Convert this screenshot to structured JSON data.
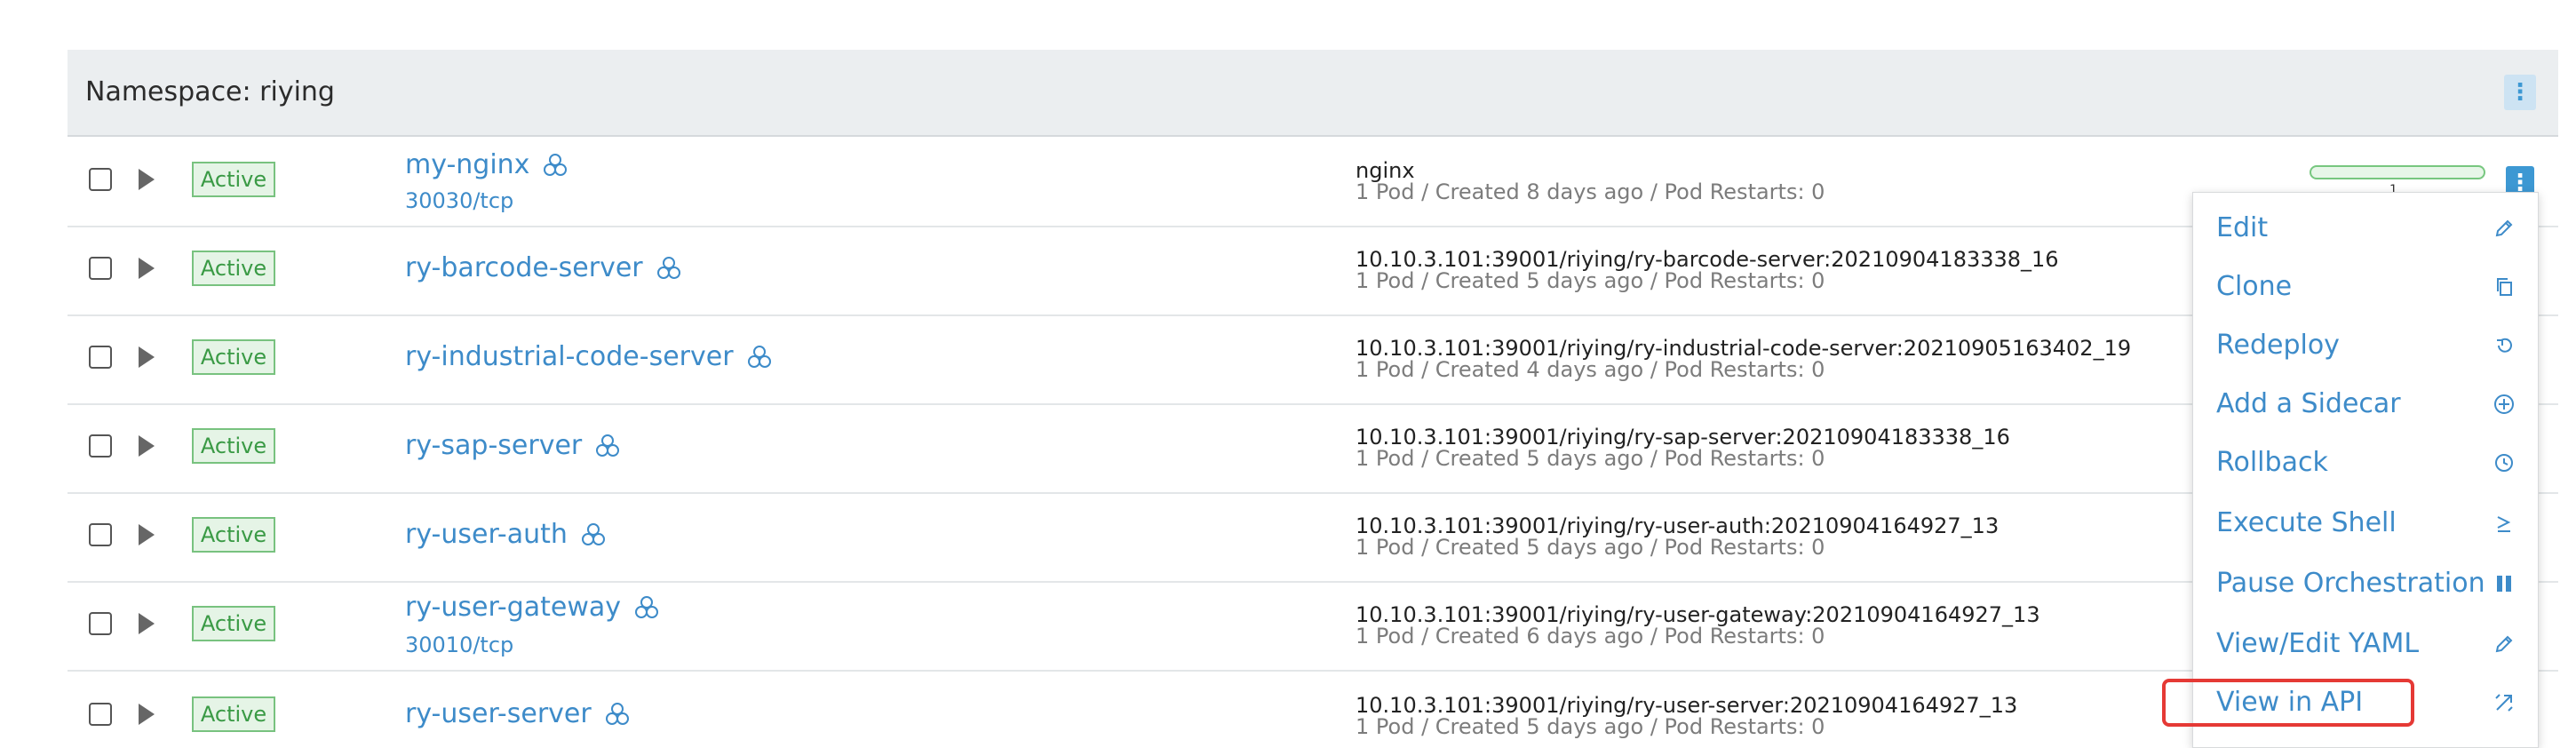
{
  "namespace_label": "Namespace: riying",
  "rows": [
    {
      "status": "Active",
      "name": "my-nginx",
      "port": "30030/tcp",
      "image": "nginx",
      "meta": "1 Pod / Created 8 days ago / Pod Restarts: 0",
      "scale": "1"
    },
    {
      "status": "Active",
      "name": "ry-barcode-server",
      "port": "",
      "image": "10.10.3.101:39001/riying/ry-barcode-server:20210904183338_16",
      "meta": "1 Pod / Created 5 days ago / Pod Restarts: 0"
    },
    {
      "status": "Active",
      "name": "ry-industrial-code-server",
      "port": "",
      "image": "10.10.3.101:39001/riying/ry-industrial-code-server:20210905163402_19",
      "meta": "1 Pod / Created 4 days ago / Pod Restarts: 0"
    },
    {
      "status": "Active",
      "name": "ry-sap-server",
      "port": "",
      "image": "10.10.3.101:39001/riying/ry-sap-server:20210904183338_16",
      "meta": "1 Pod / Created 5 days ago / Pod Restarts: 0"
    },
    {
      "status": "Active",
      "name": "ry-user-auth",
      "port": "",
      "image": "10.10.3.101:39001/riying/ry-user-auth:20210904164927_13",
      "meta": "1 Pod / Created 5 days ago / Pod Restarts: 0"
    },
    {
      "status": "Active",
      "name": "ry-user-gateway",
      "port": "30010/tcp",
      "image": "10.10.3.101:39001/riying/ry-user-gateway:20210904164927_13",
      "meta": "1 Pod / Created 6 days ago / Pod Restarts: 0"
    },
    {
      "status": "Active",
      "name": "ry-user-server",
      "port": "",
      "image": "10.10.3.101:39001/riying/ry-user-server:20210904164927_13",
      "meta": "1 Pod / Created 5 days ago / Pod Restarts: 0"
    }
  ],
  "menu": [
    {
      "label": "Edit",
      "icon": "pencil-icon"
    },
    {
      "label": "Clone",
      "icon": "copy-icon"
    },
    {
      "label": "Redeploy",
      "icon": "undo-icon"
    },
    {
      "label": "Add a Sidecar",
      "icon": "circle-plus-icon"
    },
    {
      "label": "Rollback",
      "icon": "history-icon"
    },
    {
      "label": "Execute Shell",
      "icon": "shell-icon"
    },
    {
      "label": "Pause Orchestration",
      "icon": "pause-icon"
    },
    {
      "label": "View/Edit YAML",
      "icon": "pencil-icon"
    },
    {
      "label": "View in API",
      "icon": "external-link-icon"
    }
  ],
  "colors": {
    "link": "#3d8bc9",
    "status_green": "#3a9a45",
    "accent": "#3d98d3",
    "highlight": "#e53935"
  }
}
